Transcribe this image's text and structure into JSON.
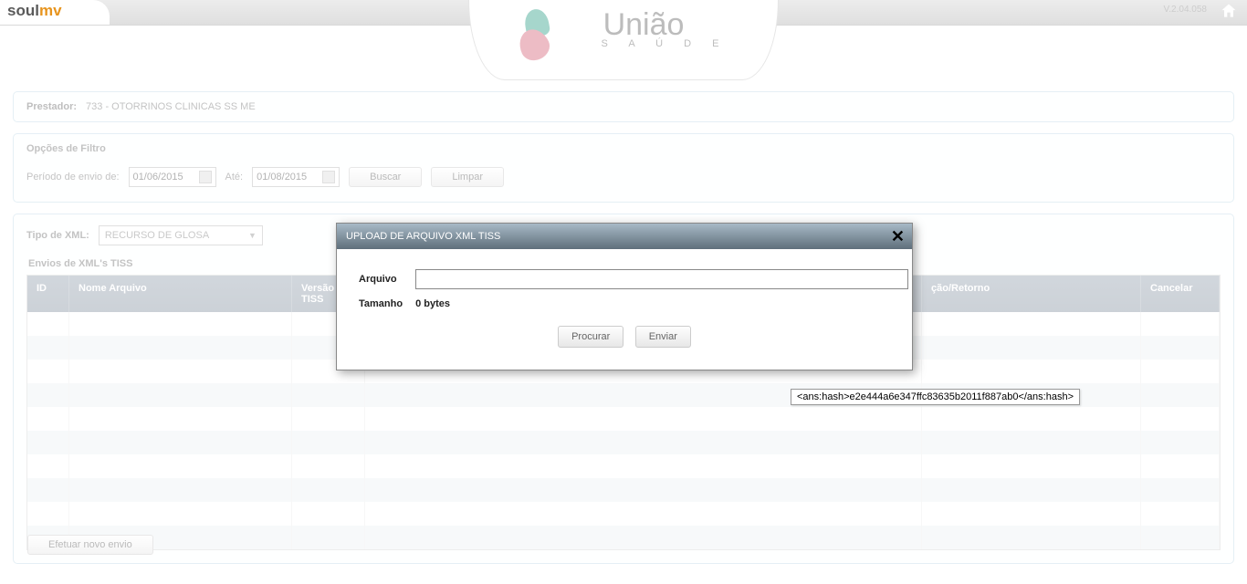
{
  "header": {
    "app_name_1": "soul",
    "app_name_2": "mv",
    "version": "V.2.04.058",
    "brand_name": "União",
    "brand_tagline": "S A Ú D E"
  },
  "prestador": {
    "label": "Prestador:",
    "value": "733 - OTORRINOS CLINICAS SS ME"
  },
  "filter": {
    "title": "Opções de Filtro",
    "periodo_label": "Período de envio de:",
    "date_from": "01/06/2015",
    "ate_label": "Até:",
    "date_to": "01/08/2015",
    "buscar": "Buscar",
    "limpar": "Limpar"
  },
  "xml": {
    "tipo_label": "Tipo de XML:",
    "tipo_value": "RECURSO DE GLOSA",
    "section_title": "Envios de XML's TISS"
  },
  "columns": {
    "id": "ID",
    "nome": "Nome Arquivo",
    "versao": "Versão TISS",
    "retorno": "ção/Retorno",
    "cancelar": "Cancelar"
  },
  "modal": {
    "title": "UPLOAD DE ARQUIVO XML TISS",
    "arquivo_label": "Arquivo",
    "tamanho_label": "Tamanho",
    "tamanho_value": "0 bytes",
    "procurar": "Procurar",
    "enviar": "Enviar"
  },
  "tooltip": {
    "hash": "<ans:hash>e2e444a6e347ffc83635b2011f887ab0</ans:hash>"
  },
  "bottom": {
    "novo_envio": "Efetuar novo envio"
  }
}
